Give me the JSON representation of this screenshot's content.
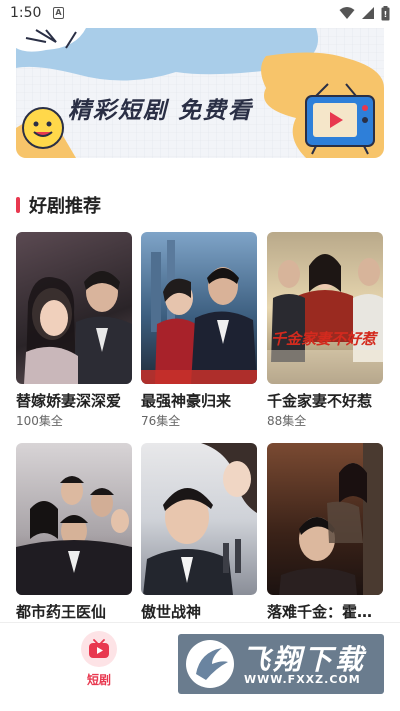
{
  "status_bar": {
    "time": "1:50",
    "notif_letter": "A"
  },
  "banner": {
    "text": "精彩短剧 免费看"
  },
  "section": {
    "title": "好剧推荐"
  },
  "dramas": [
    {
      "title": "替嫁娇妻深深爱",
      "episodes": "100集全"
    },
    {
      "title": "最强神豪归来",
      "episodes": "76集全"
    },
    {
      "title": "千金家妻不好惹",
      "episodes": "88集全",
      "poster_text": "千金家妻不好惹"
    },
    {
      "title": "都市药王医仙",
      "episodes": ""
    },
    {
      "title": "傲世战神",
      "episodes": ""
    },
    {
      "title": "落难千金：霍…",
      "episodes": ""
    }
  ],
  "bottom_nav": {
    "tab_label": "短剧",
    "accent": "#e8384f"
  },
  "watermark": {
    "title": "飞翔下载",
    "url": "WWW.FXXZ.COM"
  }
}
